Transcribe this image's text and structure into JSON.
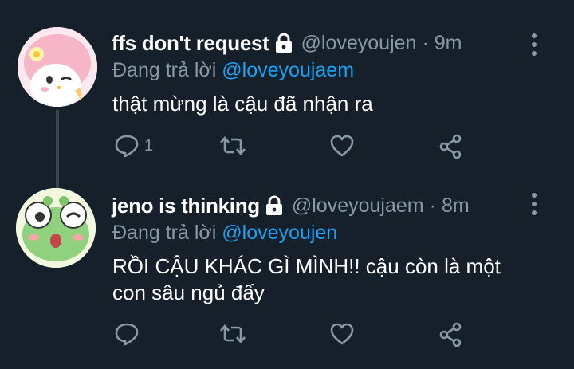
{
  "tweets": [
    {
      "display_name": "ffs don't request",
      "handle": "@loveyoujen",
      "separator": "·",
      "time": "9m",
      "replying_prefix": "Đang trả lời",
      "replying_to": "@loveyoujaem",
      "text": "thật mừng là cậu đã nhận ra",
      "reply_count": "1"
    },
    {
      "display_name": "jeno is thinking",
      "handle": "@loveyoujaem",
      "separator": "·",
      "time": "8m",
      "replying_prefix": "Đang trả lời",
      "replying_to": "@loveyoujen",
      "text": "RỒI CẬU KHÁC GÌ MÌNH!! cậu còn là một con sâu ngủ đấy",
      "reply_count": ""
    }
  ],
  "colors": {
    "background": "#15202b",
    "secondary_text": "#8899a6",
    "mention": "#1da1f2",
    "thread_line": "#38444d"
  },
  "icons": [
    "lock-icon",
    "more-icon",
    "reply-icon",
    "retweet-icon",
    "like-icon",
    "share-icon"
  ]
}
